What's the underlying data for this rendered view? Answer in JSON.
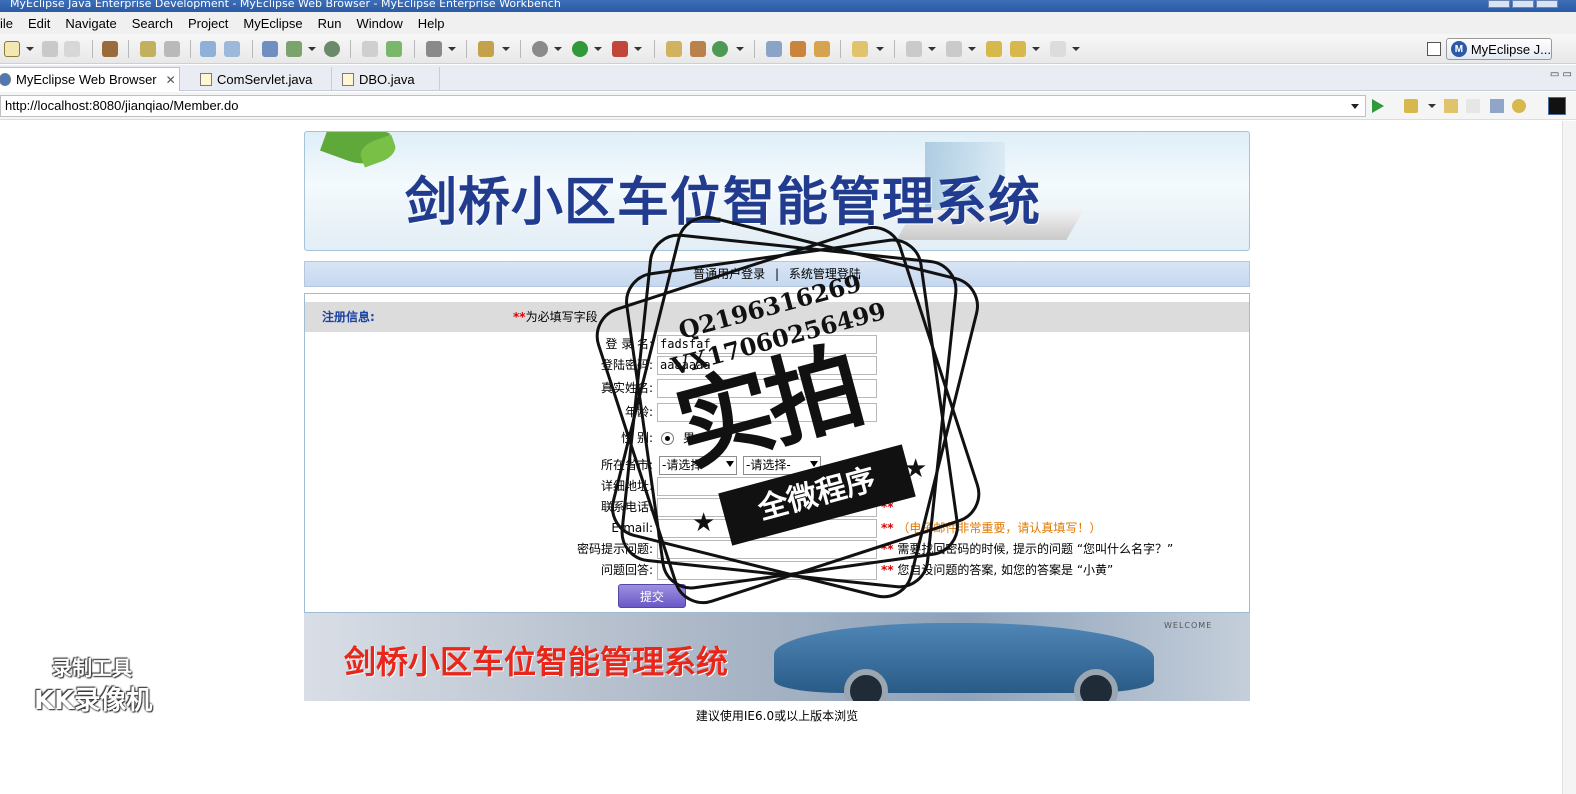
{
  "window": {
    "title": "MyEclipse Java Enterprise Development - MyEclipse Web Browser - MyEclipse Enterprise Workbench"
  },
  "menu": [
    "ile",
    "Edit",
    "Navigate",
    "Search",
    "Project",
    "MyEclipse",
    "Run",
    "Window",
    "Help"
  ],
  "perspective": {
    "label": "MyEclipse J...",
    "icon": "M"
  },
  "tabs": [
    {
      "label": "MyEclipse Web Browser",
      "close": "✕"
    },
    {
      "label": "ComServlet.java"
    },
    {
      "label": "DBO.java"
    }
  ],
  "view_controls": "▭ ▭",
  "address": {
    "url": "http://localhost:8080/jianqiao/Member.do"
  },
  "page": {
    "banner_title": "剑桥小区车位智能管理系统",
    "nav": {
      "user_login": "普通用户登录",
      "divider": "|",
      "admin_login": "系统管理登陆"
    },
    "form": {
      "section_label": "注册信息:",
      "required_mark": "**",
      "required_note": "为必填写字段",
      "fields": {
        "login_name": {
          "label": "登 录 名:",
          "value": "fadsfaf"
        },
        "password": {
          "label": "登陆密码:",
          "value": "aaaaaaa"
        },
        "real_name": {
          "label": "真实姓名:",
          "value": ""
        },
        "age": {
          "label": "年龄:",
          "value": ""
        },
        "gender": {
          "label": "性    别:",
          "option": "男"
        },
        "province": {
          "label": "所在省市:",
          "select1": "-请选择-",
          "select2": "-请选择-"
        },
        "address": {
          "label": "详细地址:",
          "value": ""
        },
        "phone": {
          "label": "联系电话:",
          "value": ""
        },
        "email": {
          "label": "E-mail:",
          "value": ""
        },
        "question": {
          "label": "密码提示问题:",
          "value": ""
        },
        "answer": {
          "label": "问题回答:",
          "value": ""
        }
      },
      "hints": {
        "phone_mark": "**",
        "email_mark": "**",
        "email_note": "（电子邮件非常重要，请认真填写！）",
        "question_mark": "**",
        "question_note": "需要找回密码的时候, 提示的问题 “您叫什么名字？”",
        "answer_mark": "**",
        "answer_note": "您自设问题的答案, 如您的答案是 “小黄”"
      },
      "submit": "提交"
    },
    "footer_title": "剑桥小区车位智能管理系统",
    "footer_welcome": "WELCOME",
    "browser_note": "建议使用IE6.0或以上版本浏览"
  },
  "overlay": {
    "recorder_line1": "录制工具",
    "recorder_line2": "KK录像机",
    "stamp_qq": "Q2196316269",
    "stamp_vx": "VX17060256499",
    "stamp_main": "实拍",
    "stamp_ribbon": "全微程序"
  }
}
